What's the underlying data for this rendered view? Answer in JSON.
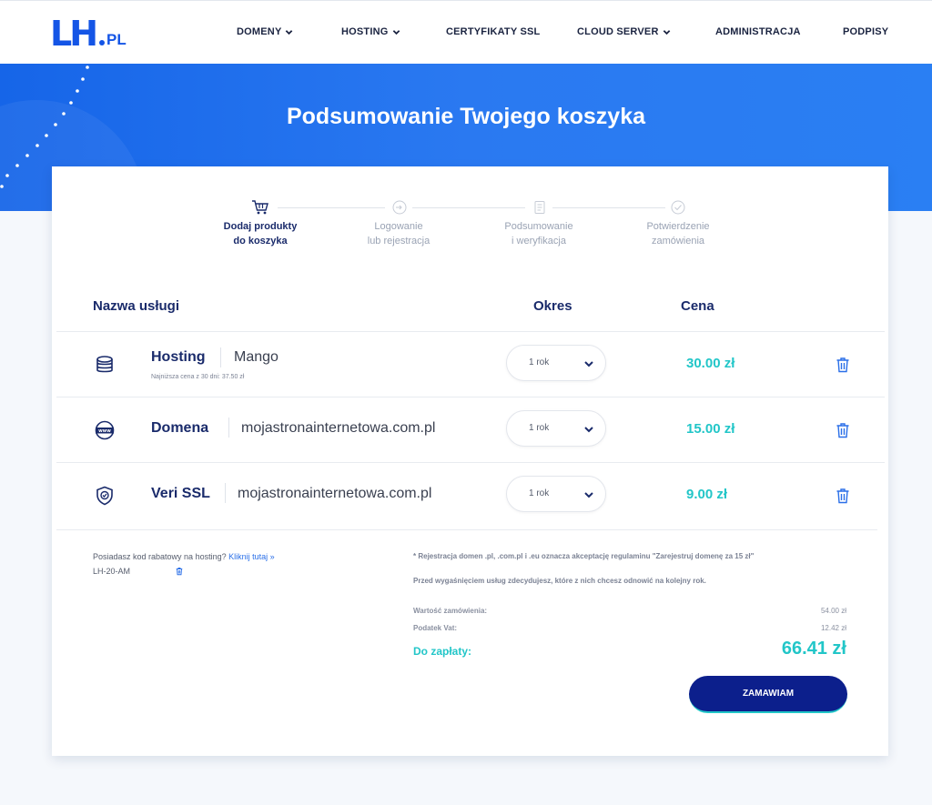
{
  "logo": {
    "main": "LH",
    "suffix": "PL"
  },
  "nav": [
    {
      "label": "DOMENY",
      "dropdown": true
    },
    {
      "label": "HOSTING",
      "dropdown": true
    },
    {
      "label": "CERTYFIKATY SSL",
      "dropdown": false
    },
    {
      "label": "CLOUD SERVER",
      "dropdown": true
    },
    {
      "label": "ADMINISTRACJA",
      "dropdown": false
    },
    {
      "label": "PODPISY",
      "dropdown": false
    }
  ],
  "hero": {
    "title": "Podsumowanie Twojego koszyka"
  },
  "steps": [
    {
      "line1": "Dodaj produkty",
      "line2": "do koszyka",
      "icon": "cart-icon",
      "active": true
    },
    {
      "line1": "Logowanie",
      "line2": "lub rejestracja",
      "icon": "login-icon",
      "active": false
    },
    {
      "line1": "Podsumowanie",
      "line2": "i weryfikacja",
      "icon": "document-icon",
      "active": false
    },
    {
      "line1": "Potwierdzenie",
      "line2": "zamówienia",
      "icon": "check-icon",
      "active": false
    }
  ],
  "table": {
    "headers": {
      "name": "Nazwa usługi",
      "period": "Okres",
      "price": "Cena"
    },
    "rows": [
      {
        "icon": "database-icon",
        "name": "Hosting",
        "value": "Mango",
        "note": "Najniższa cena z 30 dni: 37.50 zł",
        "period": "1 rok",
        "price": "30.00 zł"
      },
      {
        "icon": "www-globe-icon",
        "name": "Domena",
        "value": "mojastronainternetowa.com.pl",
        "note": "",
        "period": "1 rok",
        "price": "15.00 zł"
      },
      {
        "icon": "shield-icon",
        "name": "Veri SSL",
        "value": "mojastronainternetowa.com.pl",
        "note": "",
        "period": "1 rok",
        "price": "9.00 zł"
      }
    ]
  },
  "coupon": {
    "question": "Posiadasz kod rabatowy na hosting?",
    "link": "Kliknij tutaj »",
    "code": "LH-20-AM"
  },
  "notes": {
    "registration": "* Rejestracja domen .pl, .com.pl i .eu oznacza akceptację regulaminu \"Zarejestruj domenę za 15 zł\"",
    "renewal": "Przed wygaśnięciem usług zdecydujesz, które z nich chcesz odnowić na kolejny rok."
  },
  "summary": {
    "order_value_label": "Wartość zamówienia:",
    "order_value": "54.00 zł",
    "vat_label": "Podatek Vat:",
    "vat": "12.42 zł",
    "total_label": "Do zapłaty:",
    "total": "66.41 zł"
  },
  "order_button": "ZAMAWIAM",
  "colors": {
    "primary": "#1455e6",
    "navy": "#0c1f8c",
    "accent": "#22c6c8",
    "heading": "#1a2b6b"
  }
}
